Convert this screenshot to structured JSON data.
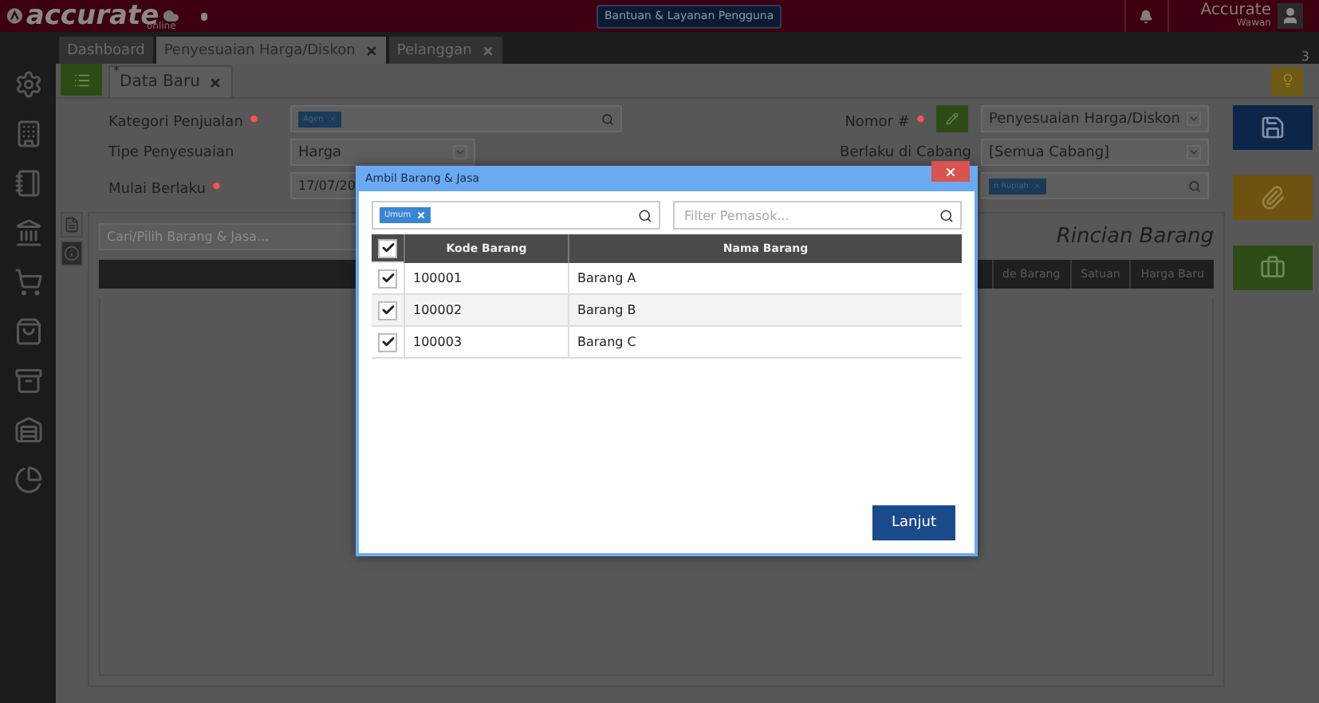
{
  "header": {
    "logo": "accurate",
    "logo_sub": "online",
    "help_button": "Bantuan & Layanan Pengguna",
    "user_name": "Accurate",
    "user_sub": "Wawan"
  },
  "tabs": [
    {
      "label": "Dashboard",
      "selected": false,
      "closable": false
    },
    {
      "label": "Penyesuaian Harga/Diskon",
      "selected": true,
      "closable": true
    },
    {
      "label": "Pelanggan",
      "selected": false,
      "closable": true
    }
  ],
  "tab_count": "3",
  "subtabs": [
    {
      "label": "Data Baru",
      "selected": true,
      "modified_mark": "*"
    }
  ],
  "form_left": [
    {
      "label": "Kategori Penjualan",
      "required_mark": "•",
      "kind": "tags",
      "tag": "Agen"
    },
    {
      "label": "Tipe Penyesuaian",
      "kind": "select",
      "value": "Harga"
    },
    {
      "label": "Mulai Berlaku",
      "required_mark": "•",
      "kind": "date",
      "value": "17/07/20"
    }
  ],
  "form_right": [
    {
      "label": "Nomor #",
      "required_mark": "•",
      "kind": "select",
      "value": "Penyesuaian Harga/Diskon"
    },
    {
      "label": "Berlaku di Cabang",
      "kind": "select",
      "value": "[Semua Cabang]"
    },
    {
      "kind": "tags",
      "tag": "n Rupiah"
    }
  ],
  "item_search": {
    "placeholder": "Cari/Pilih Barang & Jasa..."
  },
  "detail": {
    "title": "Rincian Barang",
    "columns": [
      "de Barang",
      "Satuan",
      "Harga Baru"
    ]
  },
  "dialog": {
    "title": "Ambil Barang & Jasa",
    "category_tag": "Umum",
    "supplier_filter": {
      "placeholder": "Filter Pemasok..."
    },
    "all_checked": true,
    "columns": [
      "Kode Barang",
      "Nama Barang"
    ],
    "rows": [
      {
        "code": "100001",
        "name": "Barang A",
        "checked": true
      },
      {
        "code": "100002",
        "name": "Barang B",
        "checked": true
      },
      {
        "code": "100003",
        "name": "Barang C",
        "checked": true
      }
    ],
    "button": "Lanjut"
  }
}
